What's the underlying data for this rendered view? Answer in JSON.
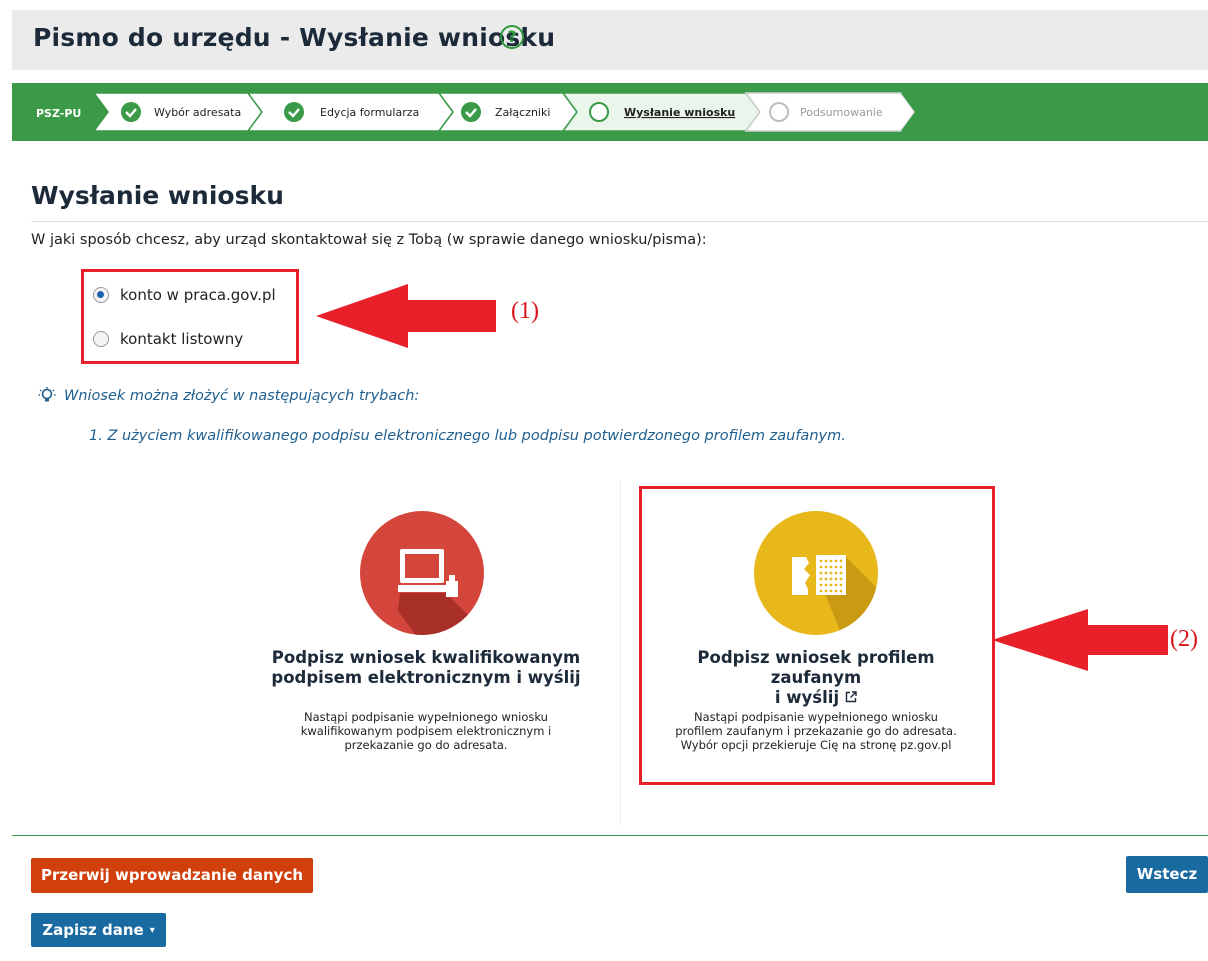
{
  "header": {
    "title": "Pismo do urzędu - Wysłanie wniosku",
    "help_icon": "?"
  },
  "wizard": {
    "code": "PSZ-PU",
    "steps": [
      {
        "label": "Wybór adresata",
        "status": "done"
      },
      {
        "label": "Edycja formularza",
        "status": "done"
      },
      {
        "label": "Załączniki",
        "status": "done"
      },
      {
        "label": "Wysłanie wniosku",
        "status": "current"
      },
      {
        "label": "Podsumowanie",
        "status": "todo"
      }
    ]
  },
  "main": {
    "title": "Wysłanie wniosku",
    "question": "W jaki sposób chcesz, aby urząd skontaktował się z Tobą (w sprawie danego wniosku/pisma):",
    "options": [
      {
        "label": "konto w praca.gov.pl",
        "checked": true
      },
      {
        "label": "kontakt listowny",
        "checked": false
      }
    ],
    "info_heading": "Wniosek można złożyć w następujących trybach:",
    "info_item": "1. Z użyciem kwalifikowanego podpisu elektronicznego lub podpisu potwierdzonego profilem zaufanym."
  },
  "annotations": {
    "first": "(1)",
    "second": "(2)"
  },
  "cards": [
    {
      "title_line1": "Podpisz wniosek kwalifikowanym",
      "title_line2": "podpisem elektronicznym i wyślij",
      "desc": "Nastąpi podpisanie wypełnionego wniosku kwalifikowanym podpisem elektronicznym i przekazanie go do adresata.",
      "icon": "computer-signature-icon",
      "color": "#d4463b"
    },
    {
      "title_line1": "Podpisz wniosek profilem zaufanym",
      "title_line2": "i wyślij",
      "desc": "Nastąpi podpisanie wypełnionego wniosku profilem zaufanym i przekazanie go do adresata. Wybór opcji przekieruje Cię na stronę pz.gov.pl",
      "icon": "trusted-profile-icon",
      "color": "#e8b81a"
    }
  ],
  "buttons": {
    "abort": "Przerwij wprowadzanie danych",
    "back": "Wstecz",
    "save": "Zapisz dane"
  },
  "colors": {
    "accent_green": "#3a9a47",
    "primary_blue": "#1a6aa2",
    "danger_orange": "#d1400c",
    "annotation_red": "#e8202a"
  }
}
